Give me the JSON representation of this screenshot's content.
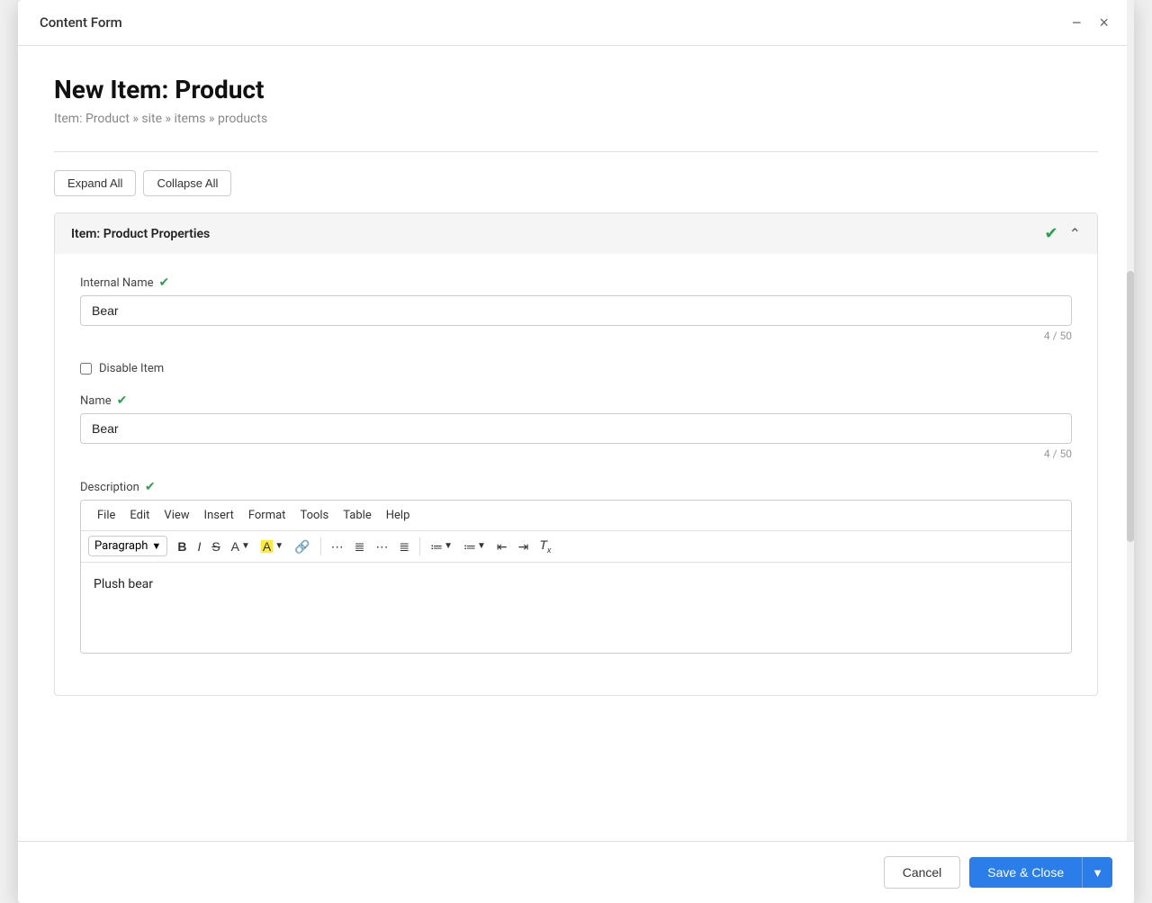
{
  "modal": {
    "title": "Content Form",
    "close_label": "×",
    "minimize_label": "−"
  },
  "page": {
    "heading": "New Item: Product",
    "breadcrumb": "Item: Product » site » items » products"
  },
  "toolbar": {
    "expand_all": "Expand All",
    "collapse_all": "Collapse All"
  },
  "section": {
    "title": "Item: Product Properties",
    "fields": {
      "internal_name": {
        "label": "Internal Name",
        "value": "Bear",
        "char_count": "4 / 50"
      },
      "disable_item": {
        "label": "Disable Item"
      },
      "name": {
        "label": "Name",
        "value": "Bear",
        "char_count": "4 / 50"
      },
      "description": {
        "label": "Description",
        "content": "Plush  bear",
        "menubar": [
          "File",
          "Edit",
          "View",
          "Insert",
          "Format",
          "Tools",
          "Table",
          "Help"
        ],
        "paragraph_select": "Paragraph"
      }
    }
  },
  "footer": {
    "cancel_label": "Cancel",
    "save_label": "Save & Close"
  },
  "icons": {
    "bold": "B",
    "italic": "I",
    "strikethrough": "S",
    "link": "🔗",
    "align_left": "≡",
    "align_center": "≡",
    "align_right": "≡",
    "align_justify": "≡",
    "ordered_list": "≔",
    "unordered_list": "≔",
    "outdent": "⇤",
    "indent": "⇥",
    "clear_format": "Tx"
  }
}
